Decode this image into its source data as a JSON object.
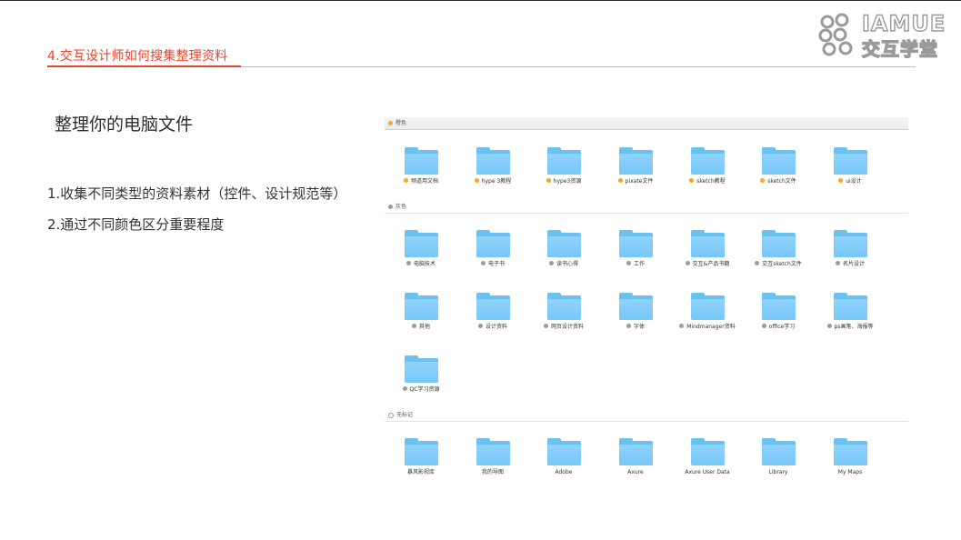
{
  "header": {
    "title": "4.交互设计师如何搜集整理资料"
  },
  "logo": {
    "line1": "IAMUE",
    "line2": "交互学堂"
  },
  "main": {
    "heading": "整理你的电脑文件",
    "bullets": [
      "1.收集不同类型的资料素材（控件、设计规范等）",
      "2.通过不同颜色区分重要程度"
    ]
  },
  "colors": {
    "accent": "#e8432f",
    "orange_tag": "#f5a623",
    "gray_tag": "#9b9b9b",
    "folder": "#77c7f8"
  },
  "finder": {
    "sections": [
      {
        "label": "橙色",
        "tag": "orange",
        "folders": [
          "频道用文档",
          "hype 3教程",
          "hype3资源",
          "pixate文件",
          "sketch教程",
          "sketch文件",
          "ui设计"
        ]
      },
      {
        "label": "灰色",
        "tag": "gray",
        "folders": [
          "电脑技术",
          "电子书",
          "读书心得",
          "工作",
          "交互&产品书籍",
          "交互sketch文件",
          "名片设计",
          "其他",
          "设计资料",
          "网页设计资料",
          "字体",
          "Mindmanager资料",
          "office学习",
          "ps画笔、海报等",
          "QC学习资源"
        ]
      },
      {
        "label": "无标记",
        "tag": "none",
        "folders": [
          "暴风影视库",
          "我的导图",
          "Adobe",
          "Axure",
          "Axure User Data",
          "Library",
          "My Maps"
        ]
      }
    ]
  }
}
